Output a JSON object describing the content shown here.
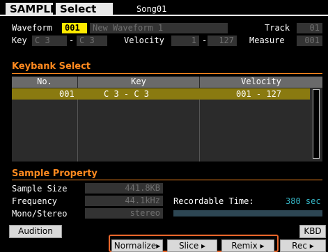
{
  "header": {
    "mode": "SAMPLE",
    "title": "Select",
    "song": "Song01"
  },
  "waveform": {
    "label": "Waveform",
    "number": "001",
    "name": "New Waveform 1"
  },
  "track": {
    "label": "Track",
    "value": "01"
  },
  "key_row": {
    "label": "Key",
    "low": "C  3",
    "dash": "-",
    "high": "C  3",
    "velocity_label": "Velocity",
    "vel_low": "1",
    "vel_dash": "-",
    "vel_high": "127",
    "measure_label": "Measure",
    "measure_value": "001"
  },
  "keybank": {
    "title": "Keybank Select",
    "columns": [
      "No.",
      "Key",
      "Velocity"
    ],
    "rows": [
      {
        "no": "001",
        "key": "C  3 - C  3",
        "velocity": "001  -  127"
      }
    ]
  },
  "property": {
    "title": "Sample Property",
    "size_label": "Sample Size",
    "size_value": "441.8KB",
    "freq_label": "Frequency",
    "freq_value": "44.1kHz",
    "mono_label": "Mono/Stereo",
    "mono_value": "stereo",
    "rec_label": "Recordable Time:",
    "rec_value": "380 sec"
  },
  "footer": {
    "audition": "Audition",
    "kbd": "KBD",
    "normalize": "Normalize",
    "slice": "Slice",
    "remix": "Remix",
    "rec": "Rec"
  },
  "icons": {
    "tab_arrow": "arrow-right-icon"
  },
  "colors": {
    "accent": "#ff8a1f",
    "selected_value": "#ffea00",
    "highlight_box": "#e9662b"
  }
}
